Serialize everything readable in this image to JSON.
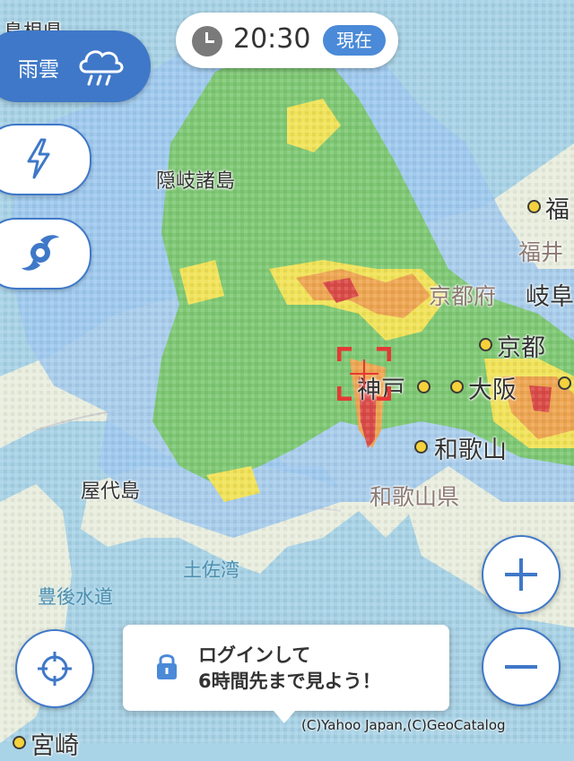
{
  "time_control": {
    "time": "20:30",
    "now_label": "現在",
    "icon": "clock-icon"
  },
  "layers": {
    "rain_label": "雨雲",
    "rain_icon": "rain-cloud-icon",
    "lightning_icon": "lightning-icon",
    "typhoon_icon": "typhoon-icon"
  },
  "map": {
    "labels": {
      "cut_top_left": "島根県",
      "oki": "隠岐諸島",
      "fuku_cut": "福",
      "fukui_cut": "福井",
      "kyoto_pref": "京都府",
      "gifu_cut": "岐阜",
      "kyoto": "京都",
      "kobe": "神戸",
      "osaka": "大阪",
      "wakayama": "和歌山",
      "wakayama_pref": "和歌山県",
      "yashiro": "屋代島",
      "tosa_bay": "土佐湾",
      "bungo": "豊後水道",
      "miyazaki_cut": "宮崎"
    },
    "colors": {
      "sea": "#a9d3e6",
      "land": "#e9eedf",
      "rain_light": "#9fc8ee",
      "rain_green": "#7cc86a",
      "rain_yellow": "#f1e35a",
      "rain_orange": "#eea653",
      "rain_red": "#d94b48",
      "accent": "#3f78c8"
    }
  },
  "controls": {
    "zoom_in_icon": "plus-icon",
    "zoom_out_icon": "minus-icon",
    "locate_icon": "current-location-icon"
  },
  "login_prompt": {
    "line1": "ログインして",
    "line2": "6時間先まで見よう！",
    "icon": "lock-icon"
  },
  "copyright": "(C)Yahoo Japan,(C)GeoCatalog"
}
